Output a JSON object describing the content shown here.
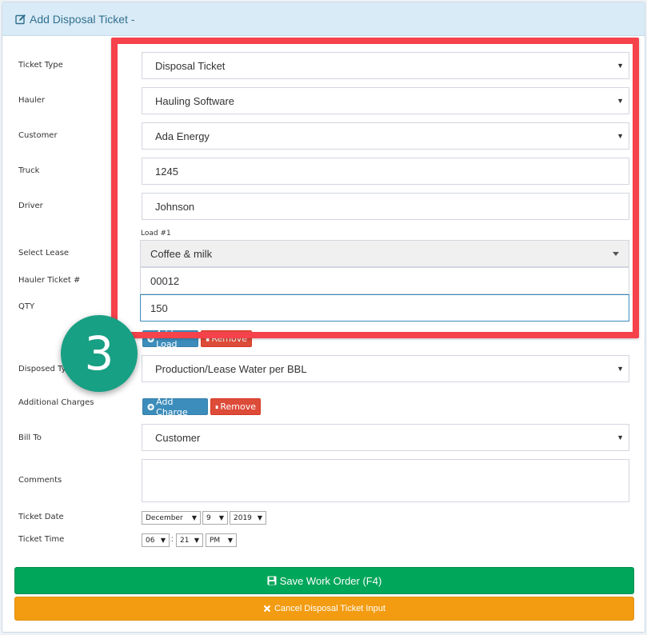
{
  "header": {
    "title": "Add Disposal Ticket -"
  },
  "labels": {
    "ticket_type": "Ticket Type",
    "hauler": "Hauler",
    "customer": "Customer",
    "truck": "Truck",
    "driver": "Driver",
    "select_lease": "Select Lease",
    "hauler_ticket": "Hauler Ticket #",
    "qty": "QTY",
    "disposed_type": "Disposed Type",
    "additional_charges": "Additional Charges",
    "bill_to": "Bill To",
    "comments": "Comments",
    "ticket_date": "Ticket Date",
    "ticket_time": "Ticket Time"
  },
  "fields": {
    "ticket_type": "Disposal Ticket",
    "hauler": "Hauling Software",
    "customer": "Ada Energy",
    "truck": "1245",
    "driver": "Johnson",
    "load_label": "Load #1",
    "lease": "Coffee & milk",
    "hauler_ticket": "00012",
    "qty": "150",
    "disposed_type": "Production/Lease Water per BBL",
    "bill_to": "Customer",
    "comments": ""
  },
  "buttons": {
    "add_load": "Add Load",
    "remove_load": "Remove",
    "add_charge": "Add Charge",
    "remove_charge": "Remove",
    "save": "Save Work Order (F4)",
    "cancel": "Cancel Disposal Ticket Input"
  },
  "date": {
    "month": "December",
    "day": "9",
    "year": "2019"
  },
  "time": {
    "hour": "06",
    "minute": "21",
    "ampm": "PM",
    "separator": ":"
  },
  "overlay": {
    "step_number": "3",
    "highlight_color": "#f5424b",
    "badge_color": "#18a084"
  },
  "colors": {
    "primary": "#3c8dbc",
    "danger": "#dd4b39",
    "success": "#00a65a",
    "warning": "#f39c12",
    "header_bg": "#d9ebf6"
  }
}
